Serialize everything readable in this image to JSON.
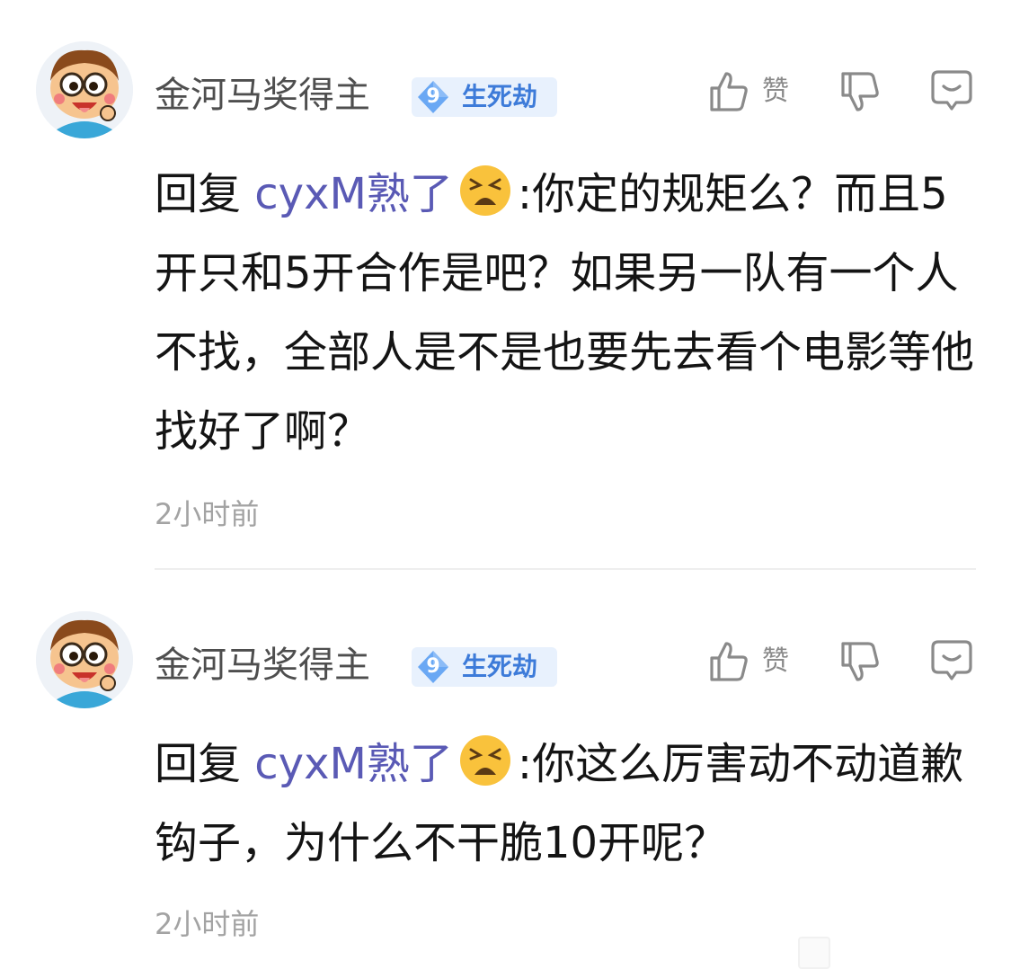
{
  "colors": {
    "mention": "#5a5ab5",
    "badge_text": "#3d7bd9",
    "badge_bg": "#e8f1fd",
    "muted": "#a3a3a3"
  },
  "comments": [
    {
      "username": "金河马奖得主",
      "badge": {
        "level": "9",
        "name": "生死劫"
      },
      "like_label": "赞",
      "reply_prefix": "回复 ",
      "mention": "cyxM熟了",
      "mention_emoji": "tired-face-emoji",
      "text": ":你定的规矩么？而且5开只和5开合作是吧？如果另一队有一个人不找，全部人是不是也要先去看个电影等他找好了啊？",
      "timestamp": "2小时前"
    },
    {
      "username": "金河马奖得主",
      "badge": {
        "level": "9",
        "name": "生死劫"
      },
      "like_label": "赞",
      "reply_prefix": "回复 ",
      "mention": "cyxM熟了",
      "mention_emoji": "tired-face-emoji",
      "text": ":你这么厉害动不动道歉钩子，为什么不干脆10开呢？",
      "timestamp": "2小时前"
    }
  ],
  "icons": {
    "like": "thumbs-up-icon",
    "dislike": "thumbs-down-icon",
    "reply": "comment-bubble-icon"
  }
}
